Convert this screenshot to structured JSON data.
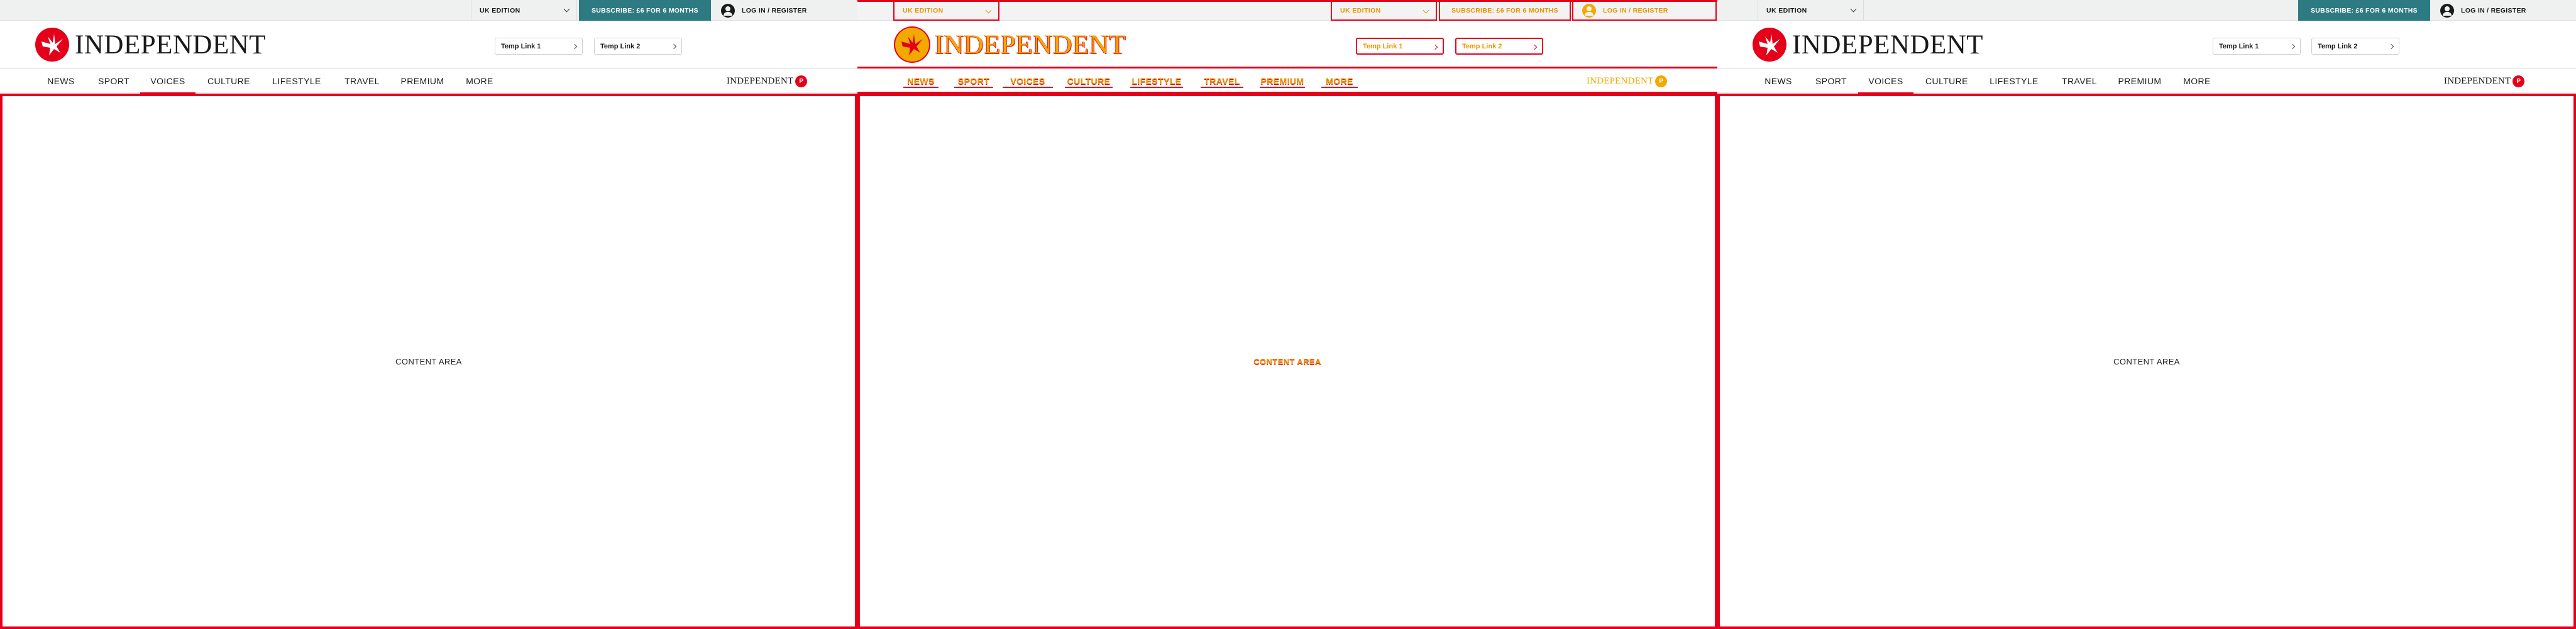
{
  "brand": {
    "red": "#e4001b",
    "teal": "#2d7a82",
    "highlight": "#f2a900"
  },
  "panels": [
    {
      "edition": "UK EDITION",
      "subscribe": "SUBSCRIBE: £6 FOR 6 MONTHS",
      "login": "LOG IN / REGISTER",
      "logo": "INDEPENDENT",
      "temp_links": [
        "Temp Link 1",
        "Temp Link 2"
      ],
      "nav": [
        "NEWS",
        "SPORT",
        "VOICES",
        "CULTURE",
        "LIFESTYLE",
        "TRAVEL",
        "PREMIUM",
        "MORE"
      ],
      "active_nav": "VOICES",
      "premium_logo": "INDEPENDENT",
      "premium_badge": "P",
      "content": "CONTENT AREA"
    },
    {
      "edition": "UK EDITION",
      "edition2": "UK EDITION",
      "subscribe": "SUBSCRIBE: £6 FOR 6 MONTHS",
      "login": "LOG IN / REGISTER",
      "logo": "INDEPENDENT",
      "temp_links": [
        "Temp Link 1",
        "Temp Link 2"
      ],
      "nav": [
        "NEWS",
        "SPORT",
        "VOICES",
        "CULTURE",
        "LIFESTYLE",
        "TRAVEL",
        "PREMIUM",
        "MORE"
      ],
      "active_nav": "VOICES",
      "premium_logo": "INDEPENDENT",
      "premium_badge": "P",
      "content": "CONTENT AREA"
    },
    {
      "edition": "UK EDITION",
      "subscribe": "SUBSCRIBE: £6 FOR 6 MONTHS",
      "login": "LOG IN / REGISTER",
      "logo": "INDEPENDENT",
      "temp_links": [
        "Temp Link 1",
        "Temp Link 2"
      ],
      "nav": [
        "NEWS",
        "SPORT",
        "VOICES",
        "CULTURE",
        "LIFESTYLE",
        "TRAVEL",
        "PREMIUM",
        "MORE"
      ],
      "active_nav": "VOICES",
      "premium_logo": "INDEPENDENT",
      "premium_badge": "P",
      "content": "CONTENT AREA"
    }
  ]
}
